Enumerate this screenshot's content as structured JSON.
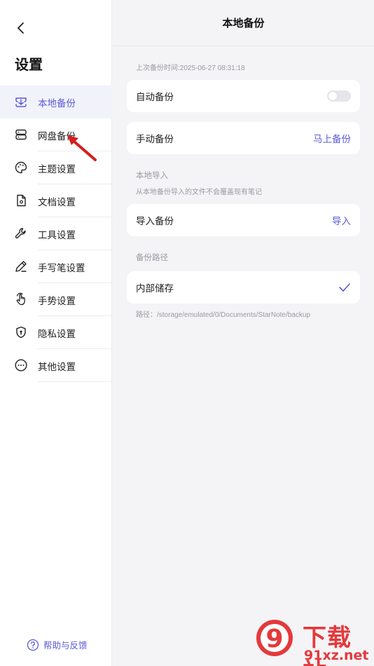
{
  "sidebar": {
    "title": "设置",
    "items": [
      {
        "label": "本地备份",
        "icon": "local-backup-icon",
        "active": true
      },
      {
        "label": "网盘备份",
        "icon": "cloud-backup-icon",
        "active": false
      },
      {
        "label": "主题设置",
        "icon": "palette-icon",
        "active": false
      },
      {
        "label": "文档设置",
        "icon": "document-icon",
        "active": false
      },
      {
        "label": "工具设置",
        "icon": "wrench-icon",
        "active": false
      },
      {
        "label": "手写笔设置",
        "icon": "pen-icon",
        "active": false
      },
      {
        "label": "手势设置",
        "icon": "gesture-icon",
        "active": false
      },
      {
        "label": "隐私设置",
        "icon": "shield-icon",
        "active": false
      },
      {
        "label": "其他设置",
        "icon": "more-icon",
        "active": false
      }
    ],
    "help_label": "帮助与反馈"
  },
  "main": {
    "title": "本地备份",
    "last_backup": "上次备份时间:2025-06-27 08:31:18",
    "auto_backup": {
      "label": "自动备份",
      "enabled": false
    },
    "manual_backup": {
      "label": "手动备份",
      "action": "马上备份"
    },
    "import_section": {
      "label": "本地导入",
      "note": "从本地备份导入的文件不会覆盖现有笔记"
    },
    "import_backup": {
      "label": "导入备份",
      "action": "导入"
    },
    "path_section": {
      "label": "备份路径"
    },
    "internal_storage": {
      "label": "内部储存",
      "selected": true
    },
    "path": "路径：/storage/emulated/0/Documents/StarNote/backup"
  },
  "watermark": {
    "text1": "下载站",
    "text2": "91xz.net",
    "logo_text": "9"
  },
  "colors": {
    "accent": "#5a5ad6",
    "arrow": "#d42020",
    "watermark": "#e4393c"
  }
}
